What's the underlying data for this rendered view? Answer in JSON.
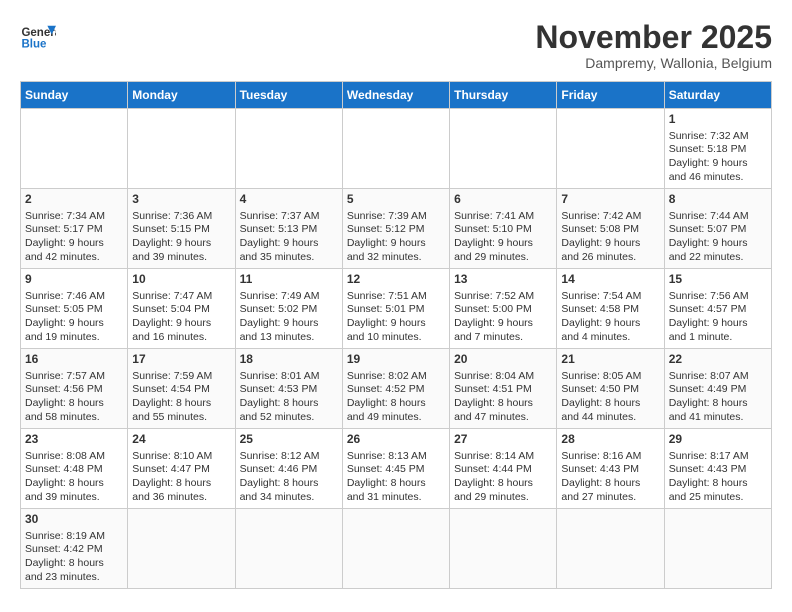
{
  "header": {
    "logo_general": "General",
    "logo_blue": "Blue",
    "month_title": "November 2025",
    "location": "Dampremy, Wallonia, Belgium"
  },
  "weekdays": [
    "Sunday",
    "Monday",
    "Tuesday",
    "Wednesday",
    "Thursday",
    "Friday",
    "Saturday"
  ],
  "weeks": [
    [
      {
        "day": "",
        "info": ""
      },
      {
        "day": "",
        "info": ""
      },
      {
        "day": "",
        "info": ""
      },
      {
        "day": "",
        "info": ""
      },
      {
        "day": "",
        "info": ""
      },
      {
        "day": "",
        "info": ""
      },
      {
        "day": "1",
        "info": "Sunrise: 7:32 AM\nSunset: 5:18 PM\nDaylight: 9 hours and 46 minutes."
      }
    ],
    [
      {
        "day": "2",
        "info": "Sunrise: 7:34 AM\nSunset: 5:17 PM\nDaylight: 9 hours and 42 minutes."
      },
      {
        "day": "3",
        "info": "Sunrise: 7:36 AM\nSunset: 5:15 PM\nDaylight: 9 hours and 39 minutes."
      },
      {
        "day": "4",
        "info": "Sunrise: 7:37 AM\nSunset: 5:13 PM\nDaylight: 9 hours and 35 minutes."
      },
      {
        "day": "5",
        "info": "Sunrise: 7:39 AM\nSunset: 5:12 PM\nDaylight: 9 hours and 32 minutes."
      },
      {
        "day": "6",
        "info": "Sunrise: 7:41 AM\nSunset: 5:10 PM\nDaylight: 9 hours and 29 minutes."
      },
      {
        "day": "7",
        "info": "Sunrise: 7:42 AM\nSunset: 5:08 PM\nDaylight: 9 hours and 26 minutes."
      },
      {
        "day": "8",
        "info": "Sunrise: 7:44 AM\nSunset: 5:07 PM\nDaylight: 9 hours and 22 minutes."
      }
    ],
    [
      {
        "day": "9",
        "info": "Sunrise: 7:46 AM\nSunset: 5:05 PM\nDaylight: 9 hours and 19 minutes."
      },
      {
        "day": "10",
        "info": "Sunrise: 7:47 AM\nSunset: 5:04 PM\nDaylight: 9 hours and 16 minutes."
      },
      {
        "day": "11",
        "info": "Sunrise: 7:49 AM\nSunset: 5:02 PM\nDaylight: 9 hours and 13 minutes."
      },
      {
        "day": "12",
        "info": "Sunrise: 7:51 AM\nSunset: 5:01 PM\nDaylight: 9 hours and 10 minutes."
      },
      {
        "day": "13",
        "info": "Sunrise: 7:52 AM\nSunset: 5:00 PM\nDaylight: 9 hours and 7 minutes."
      },
      {
        "day": "14",
        "info": "Sunrise: 7:54 AM\nSunset: 4:58 PM\nDaylight: 9 hours and 4 minutes."
      },
      {
        "day": "15",
        "info": "Sunrise: 7:56 AM\nSunset: 4:57 PM\nDaylight: 9 hours and 1 minute."
      }
    ],
    [
      {
        "day": "16",
        "info": "Sunrise: 7:57 AM\nSunset: 4:56 PM\nDaylight: 8 hours and 58 minutes."
      },
      {
        "day": "17",
        "info": "Sunrise: 7:59 AM\nSunset: 4:54 PM\nDaylight: 8 hours and 55 minutes."
      },
      {
        "day": "18",
        "info": "Sunrise: 8:01 AM\nSunset: 4:53 PM\nDaylight: 8 hours and 52 minutes."
      },
      {
        "day": "19",
        "info": "Sunrise: 8:02 AM\nSunset: 4:52 PM\nDaylight: 8 hours and 49 minutes."
      },
      {
        "day": "20",
        "info": "Sunrise: 8:04 AM\nSunset: 4:51 PM\nDaylight: 8 hours and 47 minutes."
      },
      {
        "day": "21",
        "info": "Sunrise: 8:05 AM\nSunset: 4:50 PM\nDaylight: 8 hours and 44 minutes."
      },
      {
        "day": "22",
        "info": "Sunrise: 8:07 AM\nSunset: 4:49 PM\nDaylight: 8 hours and 41 minutes."
      }
    ],
    [
      {
        "day": "23",
        "info": "Sunrise: 8:08 AM\nSunset: 4:48 PM\nDaylight: 8 hours and 39 minutes."
      },
      {
        "day": "24",
        "info": "Sunrise: 8:10 AM\nSunset: 4:47 PM\nDaylight: 8 hours and 36 minutes."
      },
      {
        "day": "25",
        "info": "Sunrise: 8:12 AM\nSunset: 4:46 PM\nDaylight: 8 hours and 34 minutes."
      },
      {
        "day": "26",
        "info": "Sunrise: 8:13 AM\nSunset: 4:45 PM\nDaylight: 8 hours and 31 minutes."
      },
      {
        "day": "27",
        "info": "Sunrise: 8:14 AM\nSunset: 4:44 PM\nDaylight: 8 hours and 29 minutes."
      },
      {
        "day": "28",
        "info": "Sunrise: 8:16 AM\nSunset: 4:43 PM\nDaylight: 8 hours and 27 minutes."
      },
      {
        "day": "29",
        "info": "Sunrise: 8:17 AM\nSunset: 4:43 PM\nDaylight: 8 hours and 25 minutes."
      }
    ],
    [
      {
        "day": "30",
        "info": "Sunrise: 8:19 AM\nSunset: 4:42 PM\nDaylight: 8 hours and 23 minutes."
      },
      {
        "day": "",
        "info": ""
      },
      {
        "day": "",
        "info": ""
      },
      {
        "day": "",
        "info": ""
      },
      {
        "day": "",
        "info": ""
      },
      {
        "day": "",
        "info": ""
      },
      {
        "day": "",
        "info": ""
      }
    ]
  ]
}
